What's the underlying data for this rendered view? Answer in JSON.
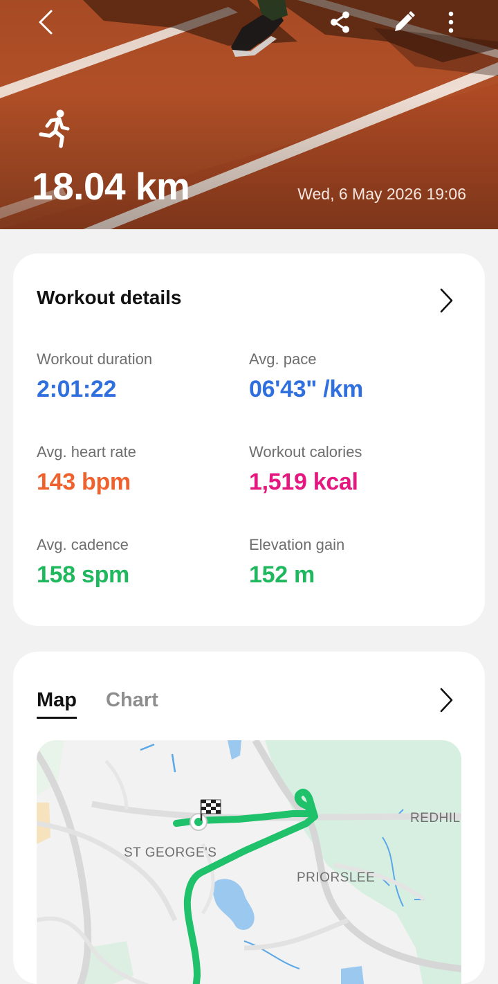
{
  "header": {
    "back_icon": "chevron-left-icon",
    "share_icon": "share-icon",
    "edit_icon": "pencil-icon",
    "more_icon": "more-vertical-icon",
    "activity_icon": "running-person-icon",
    "distance": "18.04 km",
    "datetime": "Wed, 6 May 2026 19:06"
  },
  "workout_details": {
    "title": "Workout details",
    "chevron_icon": "chevron-right-icon",
    "metrics": [
      {
        "label": "Workout duration",
        "value": "2:01:22",
        "color": "#2f6fde"
      },
      {
        "label": "Avg. pace",
        "value": "06'43\" /km",
        "color": "#2f6fde"
      },
      {
        "label": "Avg. heart rate",
        "value": "143 bpm",
        "color": "#f0622d"
      },
      {
        "label": "Workout calories",
        "value": "1,519 kcal",
        "color": "#e6177f"
      },
      {
        "label": "Avg. cadence",
        "value": "158 spm",
        "color": "#1fb85e"
      },
      {
        "label": "Elevation gain",
        "value": "152 m",
        "color": "#1fb85e"
      }
    ]
  },
  "map_section": {
    "tabs": [
      {
        "label": "Map",
        "active": true
      },
      {
        "label": "Chart",
        "active": false
      }
    ],
    "chevron_icon": "chevron-right-icon",
    "place_labels": [
      "ST GEORGE'S",
      "PRIORSLEE",
      "REDHILL"
    ],
    "route_color": "#1fc16b",
    "start_icon": "start-point-icon",
    "finish_icon": "finish-flag-icon"
  }
}
